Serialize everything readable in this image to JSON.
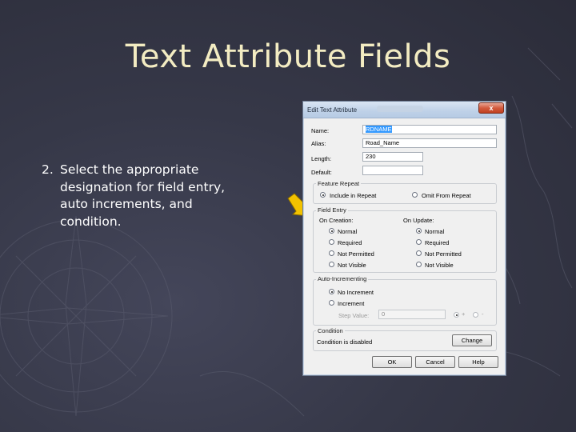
{
  "slide": {
    "title": "Text Attribute Fields",
    "bullet_number": "2.",
    "bullet_text": "Select the appropriate designation for field entry, auto increments, and condition."
  },
  "dialog": {
    "title": "Edit Text Attribute",
    "close_label": "x",
    "name_label": "Name:",
    "name_value": "RDNAME",
    "alias_label": "Alias:",
    "alias_value": "Road_Name",
    "length_label": "Length:",
    "length_value": "230",
    "default_label": "Default:",
    "default_value": "",
    "feature_repeat": {
      "title": "Feature Repeat",
      "include_label": "Include in Repeat",
      "omit_label": "Omit From Repeat",
      "selected": "include"
    },
    "field_entry": {
      "title": "Field Entry",
      "on_creation_label": "On Creation:",
      "on_update_label": "On Update:",
      "creation_options": [
        "Normal",
        "Required",
        "Not Permitted",
        "Not Visible"
      ],
      "update_options": [
        "Normal",
        "Required",
        "Not Permitted",
        "Not Visible"
      ],
      "creation_selected": "Normal",
      "update_selected": "Normal"
    },
    "auto_incrementing": {
      "title": "Auto-Incrementing",
      "no_increment_label": "No Increment",
      "increment_label": "Increment",
      "selected": "No Increment",
      "step_value_label": "Step Value:",
      "step_value": "0",
      "plus_label": "+",
      "minus_label": "-"
    },
    "condition": {
      "title": "Condition",
      "status_text": "Condition is disabled",
      "change_label": "Change"
    },
    "buttons": {
      "ok": "OK",
      "cancel": "Cancel",
      "help": "Help"
    }
  },
  "colors": {
    "background": "#363848",
    "title_text": "#f3ecc2",
    "arrow": "#f2c200",
    "selection": "#3399ff"
  }
}
